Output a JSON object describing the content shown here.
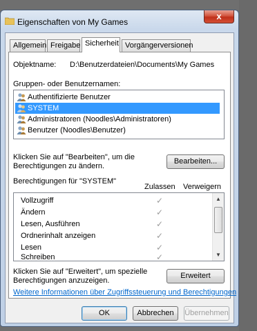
{
  "window": {
    "title": "Eigenschaften von My Games",
    "close_symbol": "x"
  },
  "tabs": [
    {
      "label": "Allgemein",
      "active": false
    },
    {
      "label": "Freigabe",
      "active": false
    },
    {
      "label": "Sicherheit",
      "active": true
    },
    {
      "label": "Vorgängerversionen",
      "active": false
    }
  ],
  "security": {
    "object_label": "Objektname:",
    "object_value": "D:\\Benutzerdateien\\Documents\\My Games",
    "groups_label": "Gruppen- oder Benutzernamen:",
    "groups": [
      {
        "name": "Authentifizierte Benutzer",
        "selected": false
      },
      {
        "name": "SYSTEM",
        "selected": true
      },
      {
        "name": "Administratoren (Noodles\\Administratoren)",
        "selected": false
      },
      {
        "name": "Benutzer (Noodles\\Benutzer)",
        "selected": false
      }
    ],
    "edit_hint": "Klicken Sie auf \"Bearbeiten\", um die Berechtigungen zu ändern.",
    "edit_button": "Bearbeiten...",
    "permissions_label": "Berechtigungen für \"SYSTEM\"",
    "allow_header": "Zulassen",
    "deny_header": "Verweigern",
    "permissions": [
      {
        "name": "Vollzugriff",
        "allow": true,
        "deny": false
      },
      {
        "name": "Ändern",
        "allow": true,
        "deny": false
      },
      {
        "name": "Lesen, Ausführen",
        "allow": true,
        "deny": false
      },
      {
        "name": "Ordnerinhalt anzeigen",
        "allow": true,
        "deny": false
      },
      {
        "name": "Lesen",
        "allow": true,
        "deny": false
      },
      {
        "name": "Schreiben",
        "allow": true,
        "deny": false
      }
    ],
    "advanced_hint": "Klicken Sie auf \"Erweitert\", um spezielle Berechtigungen anzuzeigen.",
    "advanced_button": "Erweitert",
    "info_link": "Weitere Informationen über Zugriffssteuerung und Berechtigungen"
  },
  "footer": {
    "ok": "OK",
    "cancel": "Abbrechen",
    "apply": "Übernehmen"
  },
  "icons": {
    "check_glyph": "✓",
    "scroll_up": "▲",
    "scroll_down": "▼"
  },
  "colors": {
    "selection": "#3399ff",
    "link": "#0066cc",
    "close_button": "#c0301a"
  }
}
